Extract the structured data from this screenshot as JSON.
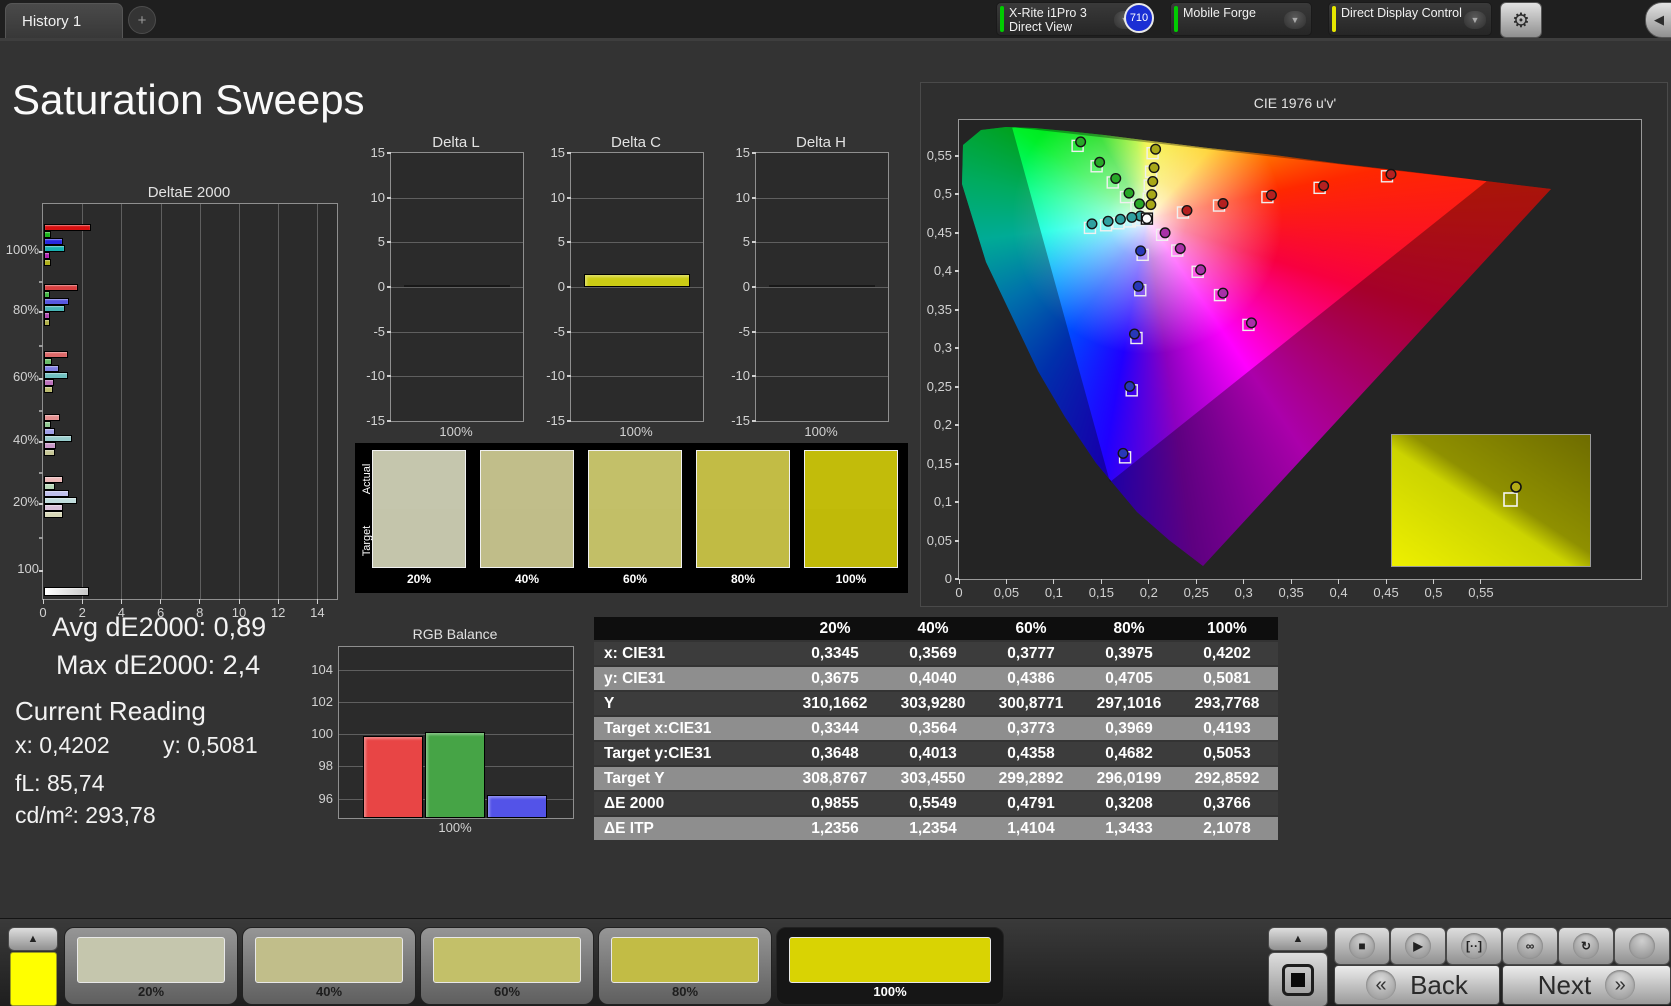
{
  "topbar": {
    "tab_label": "History 1",
    "add_tab_label": "+",
    "meter": {
      "line1": "X-Rite i1Pro 3",
      "line2": "Direct View",
      "status_color": "#00cc00"
    },
    "badge": "710",
    "source": {
      "label": "Mobile Forge",
      "status_color": "#00cc00"
    },
    "workflow": {
      "label": "Direct Display Control",
      "status_color": "#e6e600"
    }
  },
  "page_title": "Saturation Sweeps",
  "stats": {
    "avg": "Avg dE2000: 0,89",
    "max": "Max dE2000: 2,4",
    "current_reading_label": "Current Reading",
    "x": "x: 0,4202",
    "y": "y: 0,5081",
    "fl": "fL: 85,74",
    "cdm2": "cd/m²: 293,78"
  },
  "charts": {
    "deltae": {
      "type": "bar",
      "title": "DeltaE 2000",
      "xticks": [
        "0",
        "2",
        "4",
        "6",
        "8",
        "10",
        "12",
        "14"
      ],
      "xmax": 15,
      "groups": [
        {
          "label": "100%",
          "values": [
            2.4,
            0.35,
            0.95,
            1.05,
            0.3,
            0.37
          ],
          "colors": [
            "#d81010",
            "#18b418",
            "#2828e0",
            "#18b0b0",
            "#b020b0",
            "#b0b018"
          ]
        },
        {
          "label": "80%",
          "values": [
            1.75,
            0.3,
            1.25,
            1.05,
            0.3,
            0.32
          ],
          "colors": [
            "#d84040",
            "#40b440",
            "#5858e0",
            "#48b4b4",
            "#b048b0",
            "#b0b048"
          ]
        },
        {
          "label": "60%",
          "values": [
            1.2,
            0.4,
            0.75,
            1.2,
            0.5,
            0.48
          ],
          "colors": [
            "#dc6868",
            "#68bc68",
            "#8080e4",
            "#70c0c0",
            "#bc70bc",
            "#bcbc70"
          ]
        },
        {
          "label": "40%",
          "values": [
            0.8,
            0.35,
            0.55,
            1.45,
            0.6,
            0.55
          ],
          "colors": [
            "#e49090",
            "#90c890",
            "#a0a0e8",
            "#98cccc",
            "#c898c8",
            "#c8c898"
          ]
        },
        {
          "label": "20%",
          "values": [
            0.95,
            0.55,
            1.25,
            1.7,
            0.95,
            0.99
          ],
          "colors": [
            "#ecb8b8",
            "#b8d8b8",
            "#c0c0ec",
            "#c0dcdc",
            "#d8c0d8",
            "#d8d8b8"
          ]
        },
        {
          "label": "100",
          "values": [
            2.3
          ],
          "colors": [
            "#f2f2f2"
          ]
        }
      ]
    },
    "lch": {
      "yticks": [
        "15",
        "10",
        "5",
        "0",
        "-5",
        "-10",
        "-15"
      ],
      "ymax": 15,
      "xlabel": "100%",
      "panels": [
        {
          "title": "Delta L",
          "value": -0.12,
          "color": "#181818"
        },
        {
          "title": "Delta C",
          "value": 1.5,
          "color": "#cccc14"
        },
        {
          "title": "Delta H",
          "value": 0.05,
          "color": "#181818"
        }
      ]
    },
    "rgb": {
      "title": "RGB Balance",
      "yticks": [
        "104",
        "102",
        "100",
        "98",
        "96"
      ],
      "ymin": 94.8,
      "ymax": 105.4,
      "xlabel": "100%",
      "bars": [
        {
          "name": "red",
          "value": 99.9,
          "color": "#e84545"
        },
        {
          "name": "green",
          "value": 100.15,
          "color": "#46a446"
        },
        {
          "name": "blue",
          "value": 96.2,
          "color": "#5353e8"
        }
      ]
    },
    "cie": {
      "title": "CIE 1976 u'v'",
      "xticks": [
        "0",
        "0,05",
        "0,1",
        "0,15",
        "0,2",
        "0,25",
        "0,3",
        "0,35",
        "0,4",
        "0,45",
        "0,5",
        "0,55"
      ],
      "yticks": [
        "0",
        "0,05",
        "0,1",
        "0,15",
        "0,2",
        "0,25",
        "0,3",
        "0,35",
        "0,4",
        "0,45",
        "0,5",
        "0,55"
      ],
      "white": [
        0.198,
        0.468
      ],
      "sweeps": [
        {
          "name": "red",
          "color": "#b42020",
          "offset": [
            4,
            -2
          ],
          "points": [
            [
              0.236,
              0.476
            ],
            [
              0.274,
              0.485
            ],
            [
              0.325,
              0.496
            ],
            [
              0.38,
              0.508
            ],
            [
              0.451,
              0.523
            ]
          ]
        },
        {
          "name": "green",
          "color": "#28a828",
          "offset": [
            3,
            -4
          ],
          "points": [
            [
              0.187,
              0.482
            ],
            [
              0.176,
              0.496
            ],
            [
              0.162,
              0.515
            ],
            [
              0.145,
              0.536
            ],
            [
              0.125,
              0.5625
            ]
          ]
        },
        {
          "name": "blue",
          "color": "#2838b8",
          "offset": [
            -2,
            -4
          ],
          "points": [
            [
              0.1935,
              0.421
            ],
            [
              0.191,
              0.375
            ],
            [
              0.187,
              0.313
            ],
            [
              0.182,
              0.245
            ],
            [
              0.175,
              0.158
            ]
          ]
        },
        {
          "name": "cyan",
          "color": "#30a0a0",
          "offset": [
            2,
            -4
          ],
          "points": [
            [
              0.189,
              0.4662
            ],
            [
              0.18,
              0.4644
            ],
            [
              0.168,
              0.462
            ],
            [
              0.155,
              0.4594
            ],
            [
              0.138,
              0.456
            ]
          ]
        },
        {
          "name": "magenta",
          "color": "#a830a8",
          "offset": [
            3,
            -2
          ],
          "points": [
            [
              0.214,
              0.447
            ],
            [
              0.23,
              0.4266
            ],
            [
              0.2515,
              0.399
            ],
            [
              0.275,
              0.3687
            ],
            [
              0.305,
              0.33
            ]
          ]
        },
        {
          "name": "yellow",
          "color": "#a8a818",
          "offset": [
            3,
            -4
          ],
          "points": [
            [
              0.199,
              0.481
            ],
            [
              0.2,
              0.494
            ],
            [
              0.201,
              0.511
            ],
            [
              0.2024,
              0.529
            ],
            [
              0.204,
              0.553
            ]
          ]
        }
      ]
    }
  },
  "swatch_panel": {
    "row_labels": [
      "Actual",
      "Target"
    ],
    "columns": [
      {
        "label": "20%",
        "actual": "#c5c6ad",
        "target": "#c4c5ab"
      },
      {
        "label": "40%",
        "actual": "#c1be8a",
        "target": "#c0bd89"
      },
      {
        "label": "60%",
        "actual": "#c3c069",
        "target": "#c2bf67"
      },
      {
        "label": "80%",
        "actual": "#c2bc45",
        "target": "#c1bb44"
      },
      {
        "label": "100%",
        "actual": "#c2bc0a",
        "target": "#c0ba08"
      }
    ]
  },
  "table": {
    "headers": [
      "",
      "20%",
      "40%",
      "60%",
      "80%",
      "100%"
    ],
    "rows": [
      {
        "label": "x: CIE31",
        "values": [
          "0,3345",
          "0,3569",
          "0,3777",
          "0,3975",
          "0,4202"
        ]
      },
      {
        "label": "y: CIE31",
        "values": [
          "0,3675",
          "0,4040",
          "0,4386",
          "0,4705",
          "0,5081"
        ]
      },
      {
        "label": "Y",
        "values": [
          "310,1662",
          "303,9280",
          "300,8771",
          "297,1016",
          "293,7768"
        ]
      },
      {
        "label": "Target x:CIE31",
        "values": [
          "0,3344",
          "0,3564",
          "0,3773",
          "0,3969",
          "0,4193"
        ]
      },
      {
        "label": "Target y:CIE31",
        "values": [
          "0,3648",
          "0,4013",
          "0,4358",
          "0,4682",
          "0,5053"
        ]
      },
      {
        "label": "Target Y",
        "values": [
          "308,8767",
          "303,4550",
          "299,2892",
          "296,0199",
          "292,8592"
        ]
      },
      {
        "label": "ΔE 2000",
        "values": [
          "0,9855",
          "0,5549",
          "0,4791",
          "0,3208",
          "0,3766"
        ]
      },
      {
        "label": "ΔE ITP",
        "values": [
          "1,2356",
          "1,2354",
          "1,4104",
          "1,3433",
          "2,1078"
        ]
      }
    ]
  },
  "toolbar": {
    "pattern_color": "#ffff00",
    "patterns": [
      {
        "label": "20%",
        "color": "#c5c6ad",
        "active": false
      },
      {
        "label": "40%",
        "color": "#c1be8a",
        "active": false
      },
      {
        "label": "60%",
        "color": "#c3c069",
        "active": false
      },
      {
        "label": "80%",
        "color": "#c2bc45",
        "active": false
      },
      {
        "label": "100%",
        "color": "#d9d303",
        "active": true
      }
    ],
    "transport_icons": [
      {
        "name": "stop",
        "glyph": "■"
      },
      {
        "name": "play",
        "glyph": "▶"
      },
      {
        "name": "step",
        "glyph": "[··]"
      },
      {
        "name": "continuous",
        "glyph": "∞"
      },
      {
        "name": "refresh",
        "glyph": "↻"
      },
      {
        "name": "record",
        "glyph": ""
      }
    ],
    "back_label": "Back",
    "next_label": "Next"
  }
}
